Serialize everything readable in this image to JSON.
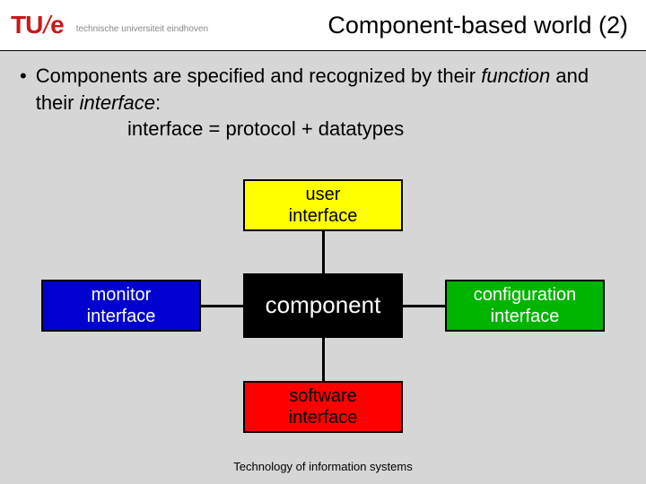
{
  "header": {
    "logo_text_1": "TU",
    "logo_slash": "/",
    "logo_text_2": "e",
    "logo_sub": "technische universiteit eindhoven",
    "title": "Component-based world (2)"
  },
  "bullet": {
    "marker": "•",
    "line1_a": "Components are specified and recognized by their ",
    "line1_b": "function",
    "line1_c": " and their ",
    "line1_d": "interface",
    "line1_e": ":",
    "line2": "interface = protocol + datatypes"
  },
  "diagram": {
    "user": "user\ninterface",
    "monitor": "monitor\ninterface",
    "component": "component",
    "configuration": "configuration\ninterface",
    "software": "software\ninterface"
  },
  "footer": "Technology of  information systems"
}
